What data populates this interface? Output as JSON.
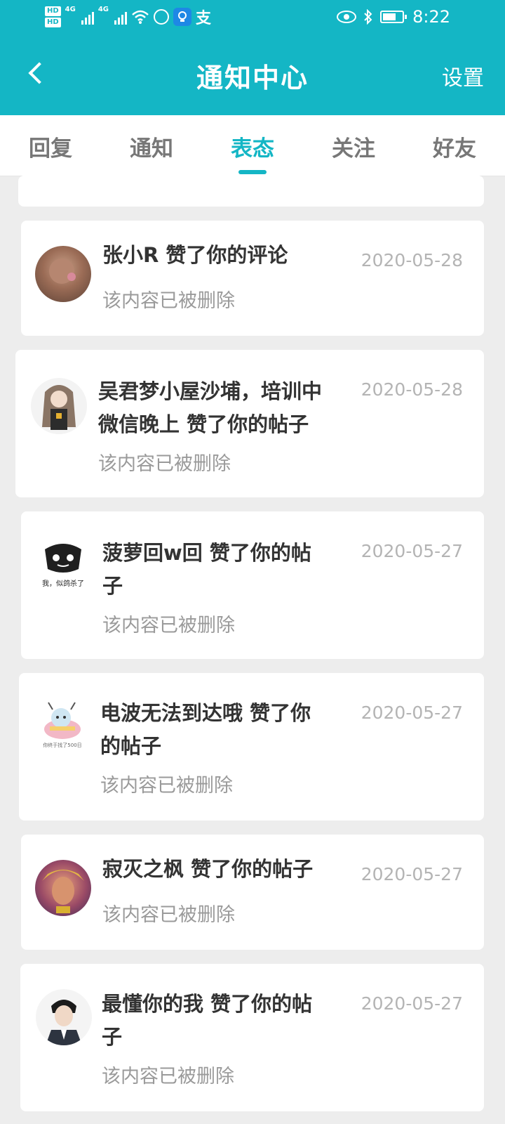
{
  "status_bar": {
    "hd1": "HD",
    "hd2": "HD",
    "net1": "4G",
    "net2": "4G",
    "alipay_label": "支",
    "time": "8:22",
    "icons": [
      "signal-icon",
      "wifi-icon",
      "hand-icon",
      "bulb-app-icon",
      "alipay-icon",
      "eye-icon",
      "bluetooth-icon",
      "battery-icon"
    ]
  },
  "header": {
    "title": "通知中心",
    "settings_label": "设置",
    "background_color": "#14b6c5"
  },
  "tabs": [
    {
      "label": "回复",
      "active": false
    },
    {
      "label": "通知",
      "active": false
    },
    {
      "label": "表态",
      "active": true
    },
    {
      "label": "关注",
      "active": false
    },
    {
      "label": "好友",
      "active": false
    }
  ],
  "notifications": [
    {
      "name_line1": "张小R 赞了你的评论",
      "name_line2": "",
      "status": "该内容已被删除",
      "date": "2020-05-28"
    },
    {
      "name_line1": "吴君梦小屋沙埔，培训中",
      "name_line2": "微信晚上 赞了你的帖子",
      "status": "该内容已被删除",
      "date": "2020-05-28"
    },
    {
      "name_line1": "菠萝回w回 赞了你的帖",
      "name_line2": "子",
      "status": "该内容已被删除",
      "date": "2020-05-27"
    },
    {
      "name_line1": "电波无法到达哦 赞了你",
      "name_line2": "的帖子",
      "status": "该内容已被删除",
      "date": "2020-05-27"
    },
    {
      "name_line1": "寂灭之枫 赞了你的帖子",
      "name_line2": "",
      "status": "该内容已被删除",
      "date": "2020-05-27"
    },
    {
      "name_line1": "最懂你的我 赞了你的帖",
      "name_line2": "子",
      "status": "该内容已被删除",
      "date": "2020-05-27"
    }
  ],
  "avatar_texts": {
    "avatar3": "我，似鸽杀了",
    "avatar4": "你终于找了500日"
  },
  "colors": {
    "accent": "#14b6c5",
    "page_bg": "#ededed"
  }
}
